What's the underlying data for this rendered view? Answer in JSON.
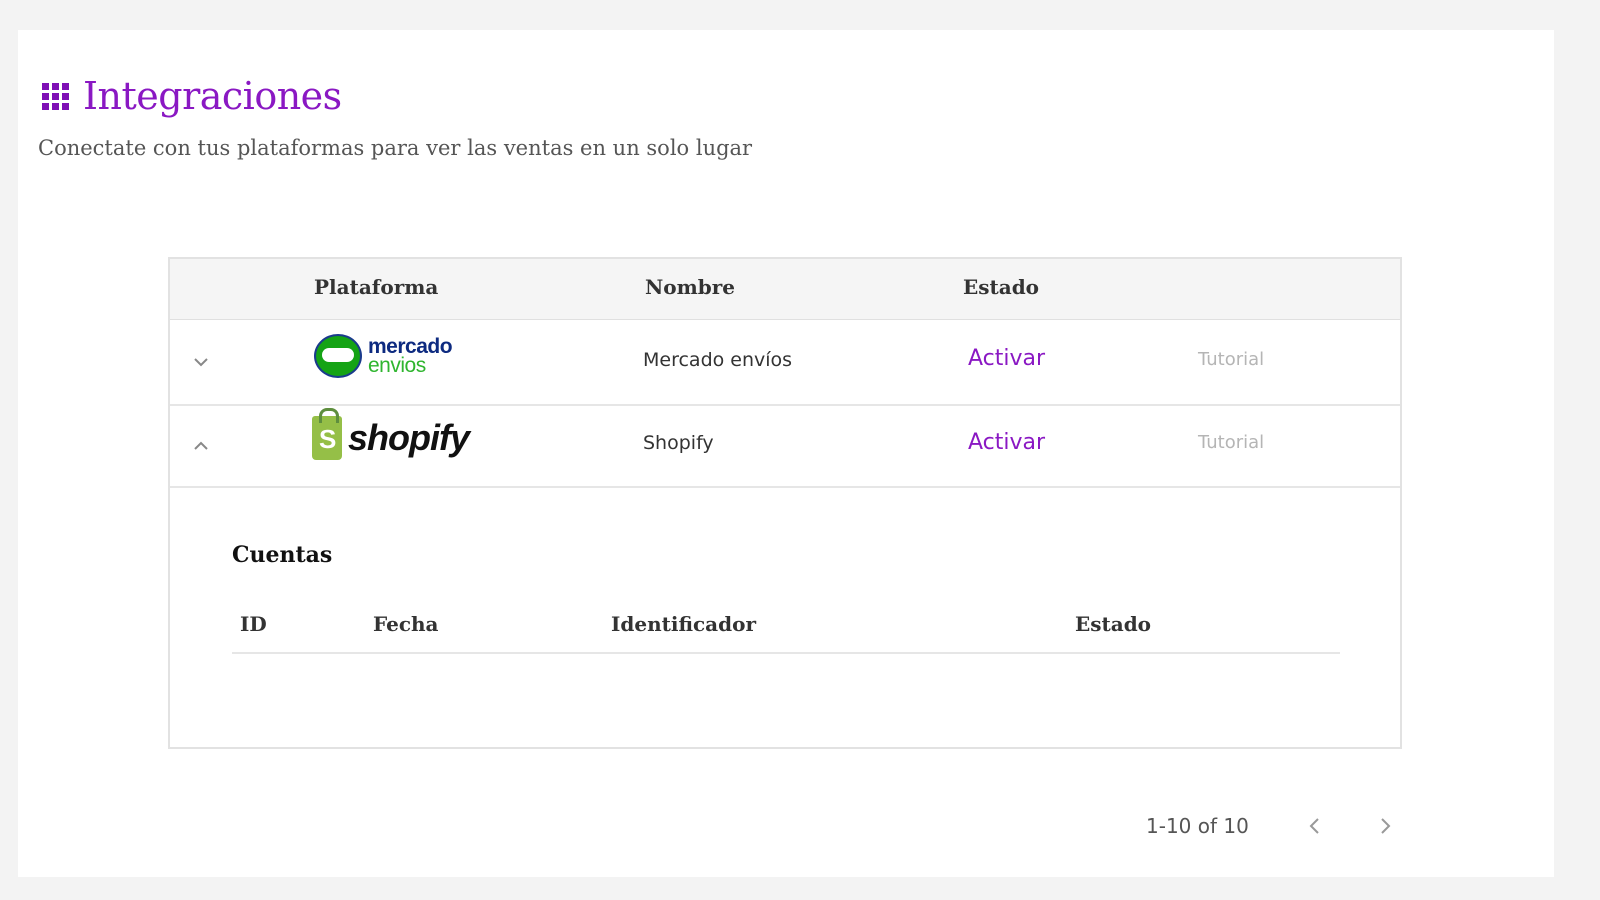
{
  "header": {
    "title": "Integraciones",
    "subtitle": "Conectate con tus plataformas para ver las ventas en un solo lugar",
    "accent_color": "#8a18c3"
  },
  "table": {
    "columns": [
      "Plataforma",
      "Nombre",
      "Estado"
    ],
    "rows": [
      {
        "logo": {
          "line1": "mercado",
          "line2": "envios"
        },
        "name": "Mercado envíos",
        "estado": "Activar",
        "tutorial": "Tutorial",
        "expanded": false
      },
      {
        "logo": {
          "line1": "shopify"
        },
        "name": "Shopify",
        "estado": "Activar",
        "tutorial": "Tutorial",
        "expanded": true
      }
    ]
  },
  "accounts": {
    "title": "Cuentas",
    "columns": [
      "ID",
      "Fecha",
      "Identificador",
      "Estado"
    ]
  },
  "pagination": {
    "range": "1-10 of 10"
  },
  "icons": {
    "header": "apps-grid-icon",
    "expand": "chevron-down-icon",
    "collapse": "chevron-up-icon",
    "prev": "chevron-left-icon",
    "next": "chevron-right-icon"
  }
}
